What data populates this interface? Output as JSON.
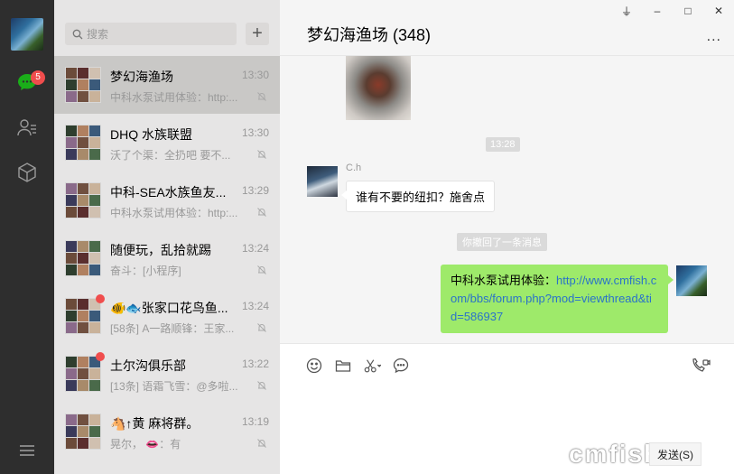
{
  "sidebar": {
    "chat_badge": "5",
    "icons": [
      "avatar",
      "chat-icon",
      "contacts-icon",
      "cube-icon",
      "menu-icon"
    ]
  },
  "search": {
    "placeholder": "搜索"
  },
  "conversations": [
    {
      "name": "梦幻海渔场",
      "time": "13:30",
      "preview": "中科水泵试用体验：http:...",
      "active": true,
      "unread": false
    },
    {
      "name": "DHQ 水族联盟",
      "time": "13:30",
      "preview": "沃了个渠：全扔吧 要不...",
      "active": false,
      "unread": false
    },
    {
      "name": "中科-SEA水族鱼友...",
      "time": "13:29",
      "preview": "中科水泵试用体验：http:...",
      "active": false,
      "unread": false
    },
    {
      "name": "随便玩，乱拾就踢",
      "time": "13:24",
      "preview": "奋斗：[小程序]",
      "active": false,
      "unread": false
    },
    {
      "name": "🐠🐟张家口花鸟鱼...",
      "time": "13:24",
      "preview": "[58条] A一路顺锋：王家...",
      "active": false,
      "unread": true
    },
    {
      "name": "土尔沟俱乐部",
      "time": "13:22",
      "preview": "[13条] 语霜飞雪：@多啦...",
      "active": false,
      "unread": true
    },
    {
      "name": "🐴↑黄  麻将群。",
      "time": "13:19",
      "preview": "晃尔，  👄：有",
      "active": false,
      "unread": false
    }
  ],
  "chat": {
    "title": "梦幻海渔场 (348)",
    "more": "...",
    "window_buttons": [
      "⏚",
      "–",
      "□",
      "✕"
    ],
    "timestamp": "13:28",
    "peer_name": "C.h",
    "incoming_text": "谁有不要的纽扣？施舍点",
    "system_notice": "你撤回了一条消息",
    "outgoing_prefix": "中科水泵试用体验：",
    "outgoing_link": "http://www.cmfish.com/bbs/forum.php?mod=viewthread&tid=586937"
  },
  "composer": {
    "send_label": "发送(S)",
    "watermark": "cmfish"
  },
  "colors": {
    "rail": "#2e2e2e",
    "list_bg": "#e6e5e5",
    "active_row": "#c9c8c6",
    "outgoing_bubble": "#9eea6a",
    "link": "#2a73c9",
    "badge": "#f04d4d"
  }
}
